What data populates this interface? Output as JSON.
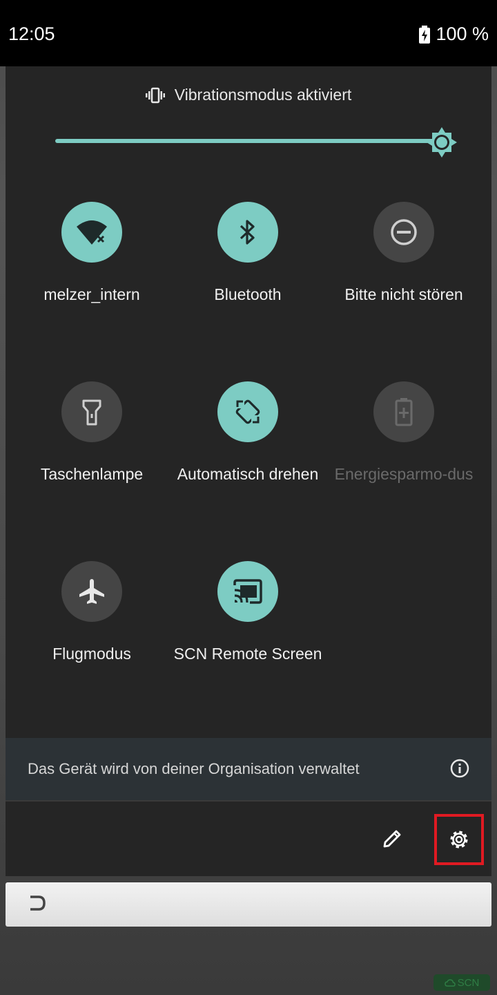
{
  "status_bar": {
    "time": "12:05",
    "battery": "100 %"
  },
  "quick_settings": {
    "ringer_mode": "Vibrationsmodus aktiviert",
    "brightness_level": 1.0,
    "tiles": [
      {
        "label": "melzer_intern",
        "icon": "wifi-no-internet-icon",
        "state": "on"
      },
      {
        "label": "Bluetooth",
        "icon": "bluetooth-icon",
        "state": "on"
      },
      {
        "label": "Bitte nicht stören",
        "icon": "do-not-disturb-icon",
        "state": "off"
      },
      {
        "label": "Taschenlampe",
        "icon": "flashlight-icon",
        "state": "off"
      },
      {
        "label": "Automatisch drehen",
        "icon": "auto-rotate-icon",
        "state": "on"
      },
      {
        "label": "Energiesparmo-dus",
        "icon": "battery-saver-icon",
        "state": "disabled"
      },
      {
        "label": "Flugmodus",
        "icon": "airplane-icon",
        "state": "off"
      },
      {
        "label": "SCN Remote Screen",
        "icon": "cast-icon",
        "state": "on"
      }
    ],
    "org_notice": "Das Gerät wird von deiner Organisation verwaltet"
  },
  "badge": {
    "text": "SCN"
  },
  "colors": {
    "accent": "#7dccc3",
    "tile_off": "#454545",
    "panel": "#252525",
    "highlight": "#e01a22"
  }
}
